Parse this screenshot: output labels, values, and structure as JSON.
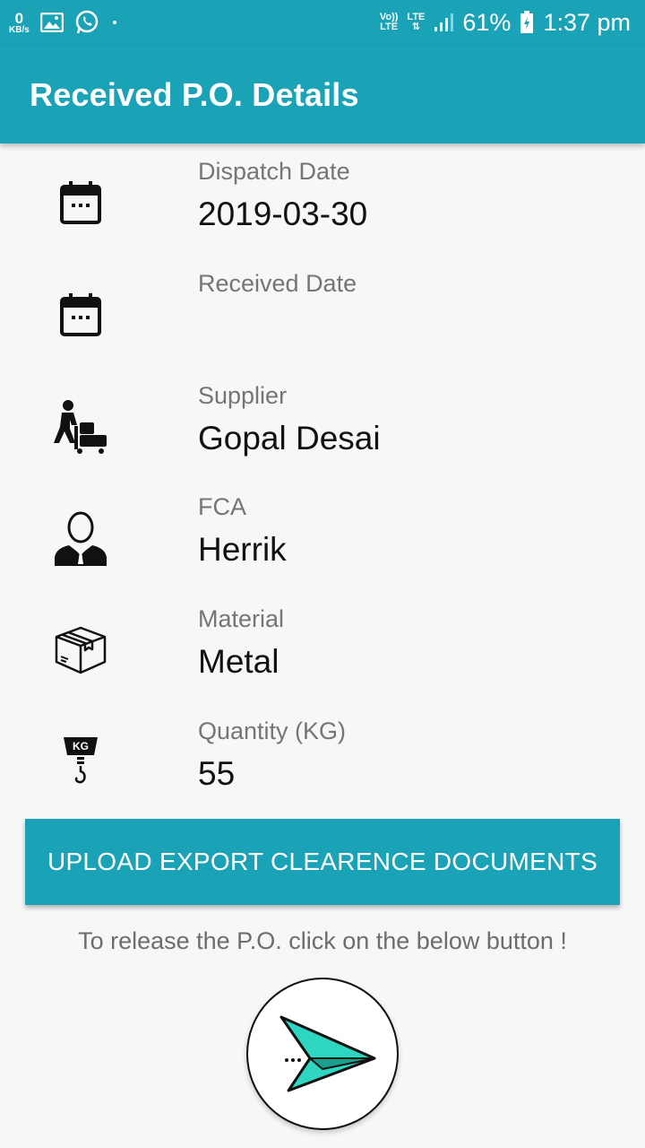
{
  "status_bar": {
    "kbs_value": "0",
    "kbs_unit": "KB/s",
    "volte": "Vo))\nLTE",
    "lte": "LTE",
    "battery": "61%",
    "time": "1:37 pm"
  },
  "app_bar": {
    "title": "Received P.O. Details"
  },
  "rows": [
    {
      "label": "Dispatch Date",
      "value": "2019-03-30",
      "icon": "calendar-icon"
    },
    {
      "label": "Received Date",
      "value": "",
      "icon": "calendar-icon"
    },
    {
      "label": "Supplier",
      "value": "Gopal Desai",
      "icon": "delivery-person-icon"
    },
    {
      "label": "FCA",
      "value": "Herrik",
      "icon": "person-suit-icon"
    },
    {
      "label": "Material",
      "value": "Metal",
      "icon": "package-box-icon"
    },
    {
      "label": "Quantity (KG)",
      "value": "55",
      "icon": "weight-scale-icon"
    }
  ],
  "upload_button": {
    "label": "UPLOAD EXPORT CLEARENCE DOCUMENTS"
  },
  "hint": {
    "text": "To release the P.O. click on the below button !"
  },
  "weight_icon_text": "KG",
  "colors": {
    "primary": "#1aa3b6",
    "send_accent": "#2ed6c2"
  }
}
